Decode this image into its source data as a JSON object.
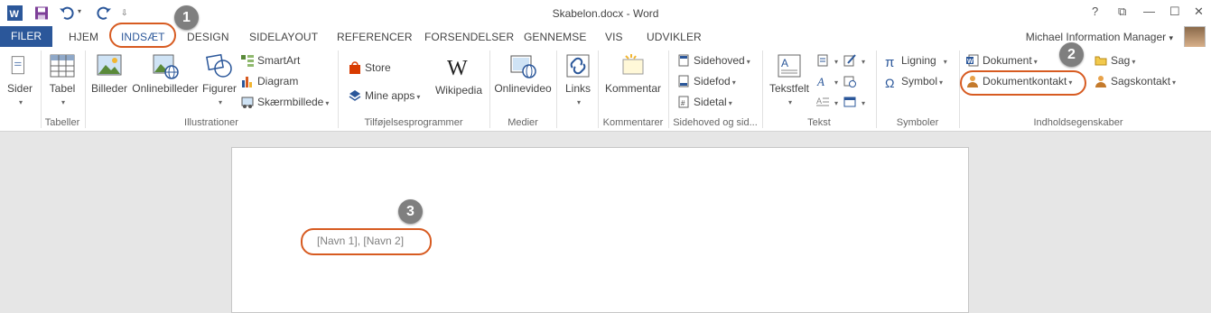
{
  "window": {
    "title": "Skabelon.docx - Word",
    "help": "?",
    "restore_ribbon": "⧉",
    "minimize": "—",
    "maximize": "☐",
    "close": "✕"
  },
  "tabs": {
    "file": "FILER",
    "items": [
      "HJEM",
      "INDSÆT",
      "DESIGN",
      "SIDELAYOUT",
      "REFERENCER",
      "FORSENDELSER",
      "GENNEMSE",
      "VIS",
      "UDVIKLER"
    ],
    "active": "INDSÆT"
  },
  "user": {
    "name": "Michael Information Manager",
    "caret": "▾"
  },
  "ribbon": {
    "sider": "Sider",
    "tabel": "Tabel",
    "billeder": "Billeder",
    "onlinebilleder": "Onlinebilleder",
    "figurer": "Figurer",
    "smartart": "SmartArt",
    "diagram": "Diagram",
    "skaermbillede": "Skærmbillede",
    "store": "Store",
    "mine_apps": "Mine apps",
    "wikipedia": "Wikipedia",
    "onlinevideo": "Onlinevideo",
    "links": "Links",
    "kommentar": "Kommentar",
    "sidehoved": "Sidehoved",
    "sidefod": "Sidefod",
    "sidetal": "Sidetal",
    "tekstfelt": "Tekstfelt",
    "ligning": "Ligning",
    "symbol": "Symbol",
    "dokument": "Dokument",
    "dokumentkontakt": "Dokumentkontakt",
    "sag": "Sag",
    "sagskontakt": "Sagskontakt",
    "groups": {
      "tabeller": "Tabeller",
      "illustrationer": "Illustrationer",
      "tilfoejelsesprogrammer": "Tilføjelsesprogrammer",
      "medier": "Medier",
      "kommentarer": "Kommentarer",
      "sidehoved_og_sidefod": "Sidehoved og sid...",
      "tekst": "Tekst",
      "symboler": "Symboler",
      "indholdsegenskaber": "Indholdsegenskaber"
    }
  },
  "document": {
    "placeholder_text": "[Navn 1], [Navn 2]"
  },
  "callouts": [
    "1",
    "2",
    "3"
  ],
  "colors": {
    "accent": "#2b579a",
    "highlight": "#d75b21",
    "badge": "#7f7f7f"
  }
}
